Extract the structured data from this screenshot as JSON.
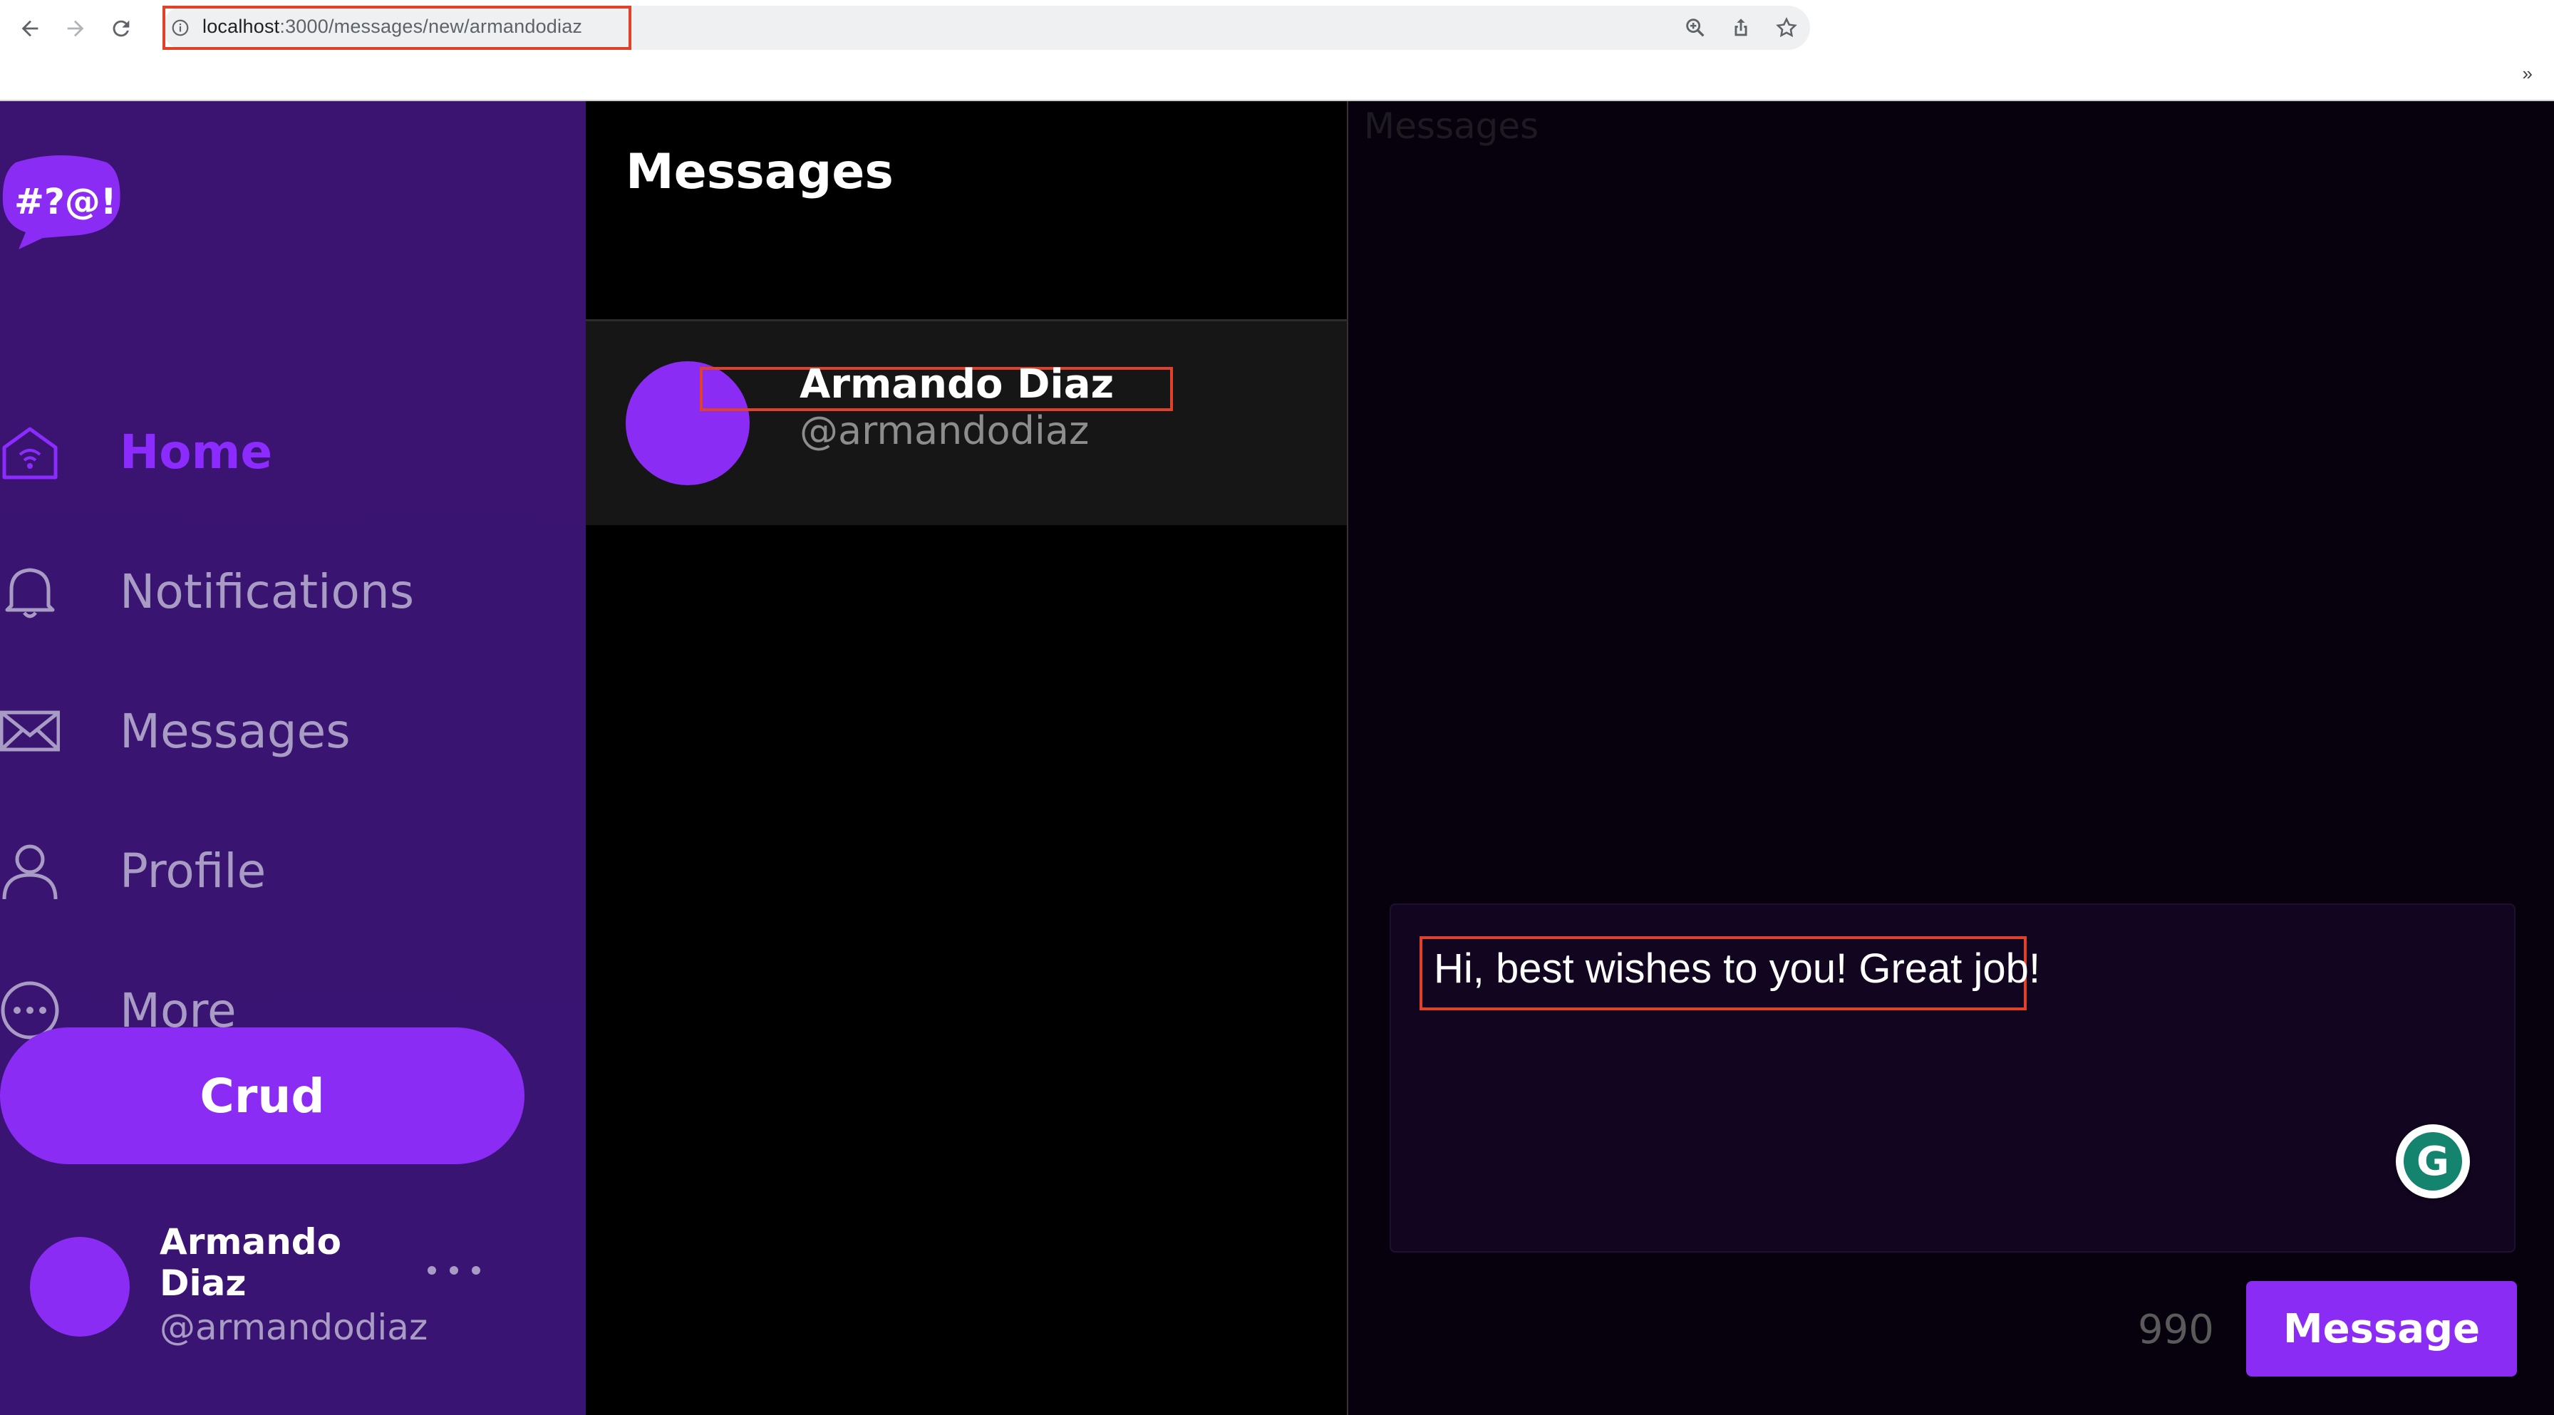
{
  "browser": {
    "url_host": "localhost",
    "url_path": ":3000/messages/new/armandodiaz",
    "overflow_glyph": "»"
  },
  "sidebar": {
    "logo_text": "#?@!",
    "items": [
      {
        "label": "Home",
        "icon": "home-icon",
        "active": true
      },
      {
        "label": "Notifications",
        "icon": "bell-icon",
        "active": false
      },
      {
        "label": "Messages",
        "icon": "envelope-icon",
        "active": false
      },
      {
        "label": "Profile",
        "icon": "user-icon",
        "active": false
      },
      {
        "label": "More",
        "icon": "more-circle-icon",
        "active": false
      }
    ],
    "action_button": "Crud",
    "current_user": {
      "name": "Armando Diaz",
      "handle": "@armandodiaz"
    }
  },
  "middle": {
    "title": "Messages",
    "conversations": [
      {
        "name": "Armando Diaz",
        "handle": "@armandodiaz"
      }
    ]
  },
  "right": {
    "ghost_title": "Messages",
    "composer_value": "Hi, best wishes to you! Great job!",
    "grammarly_letter": "G",
    "char_count": "990",
    "send_label": "Message"
  },
  "colors": {
    "accent": "#8b2cf5",
    "sidebar_bg": "#3a1470",
    "highlight_box": "#e0412a"
  }
}
